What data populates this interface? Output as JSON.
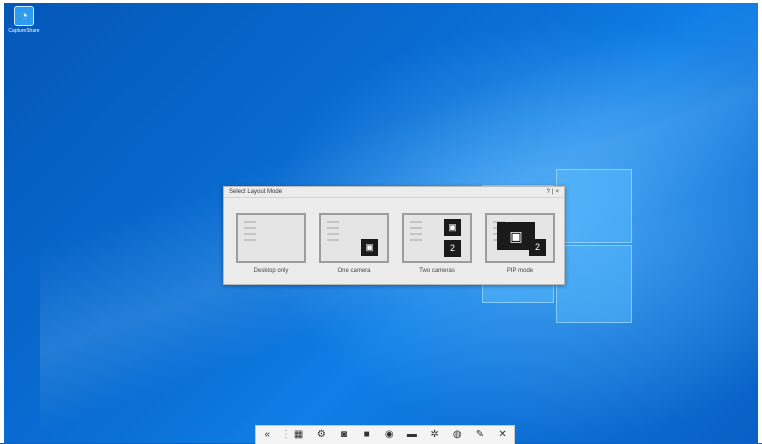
{
  "desktop": {
    "icon_label": "CaptureShare"
  },
  "dialog": {
    "title": "Select Layout Mode",
    "help": "?",
    "close": "×",
    "options": [
      {
        "label": "Desktop only"
      },
      {
        "label": "One camera"
      },
      {
        "label": "Two cameras"
      },
      {
        "label": "PIP mode"
      }
    ]
  },
  "toolbar": {
    "items": [
      {
        "icon": "collapse-icon",
        "glyph": "«"
      },
      {
        "icon": "separator",
        "glyph": "⋮"
      },
      {
        "icon": "layout-icon",
        "glyph": "▦"
      },
      {
        "icon": "camera-settings-icon",
        "glyph": "⚙"
      },
      {
        "icon": "snapshot-icon",
        "glyph": "◙"
      },
      {
        "icon": "record-icon",
        "glyph": "■"
      },
      {
        "icon": "broadcast-icon",
        "glyph": "◉"
      },
      {
        "icon": "folder-icon",
        "glyph": "▬"
      },
      {
        "icon": "settings-icon",
        "glyph": "✲"
      },
      {
        "icon": "user-icon",
        "glyph": "◍"
      },
      {
        "icon": "pen-icon",
        "glyph": "✎"
      },
      {
        "icon": "close-icon",
        "glyph": "✕"
      }
    ]
  }
}
